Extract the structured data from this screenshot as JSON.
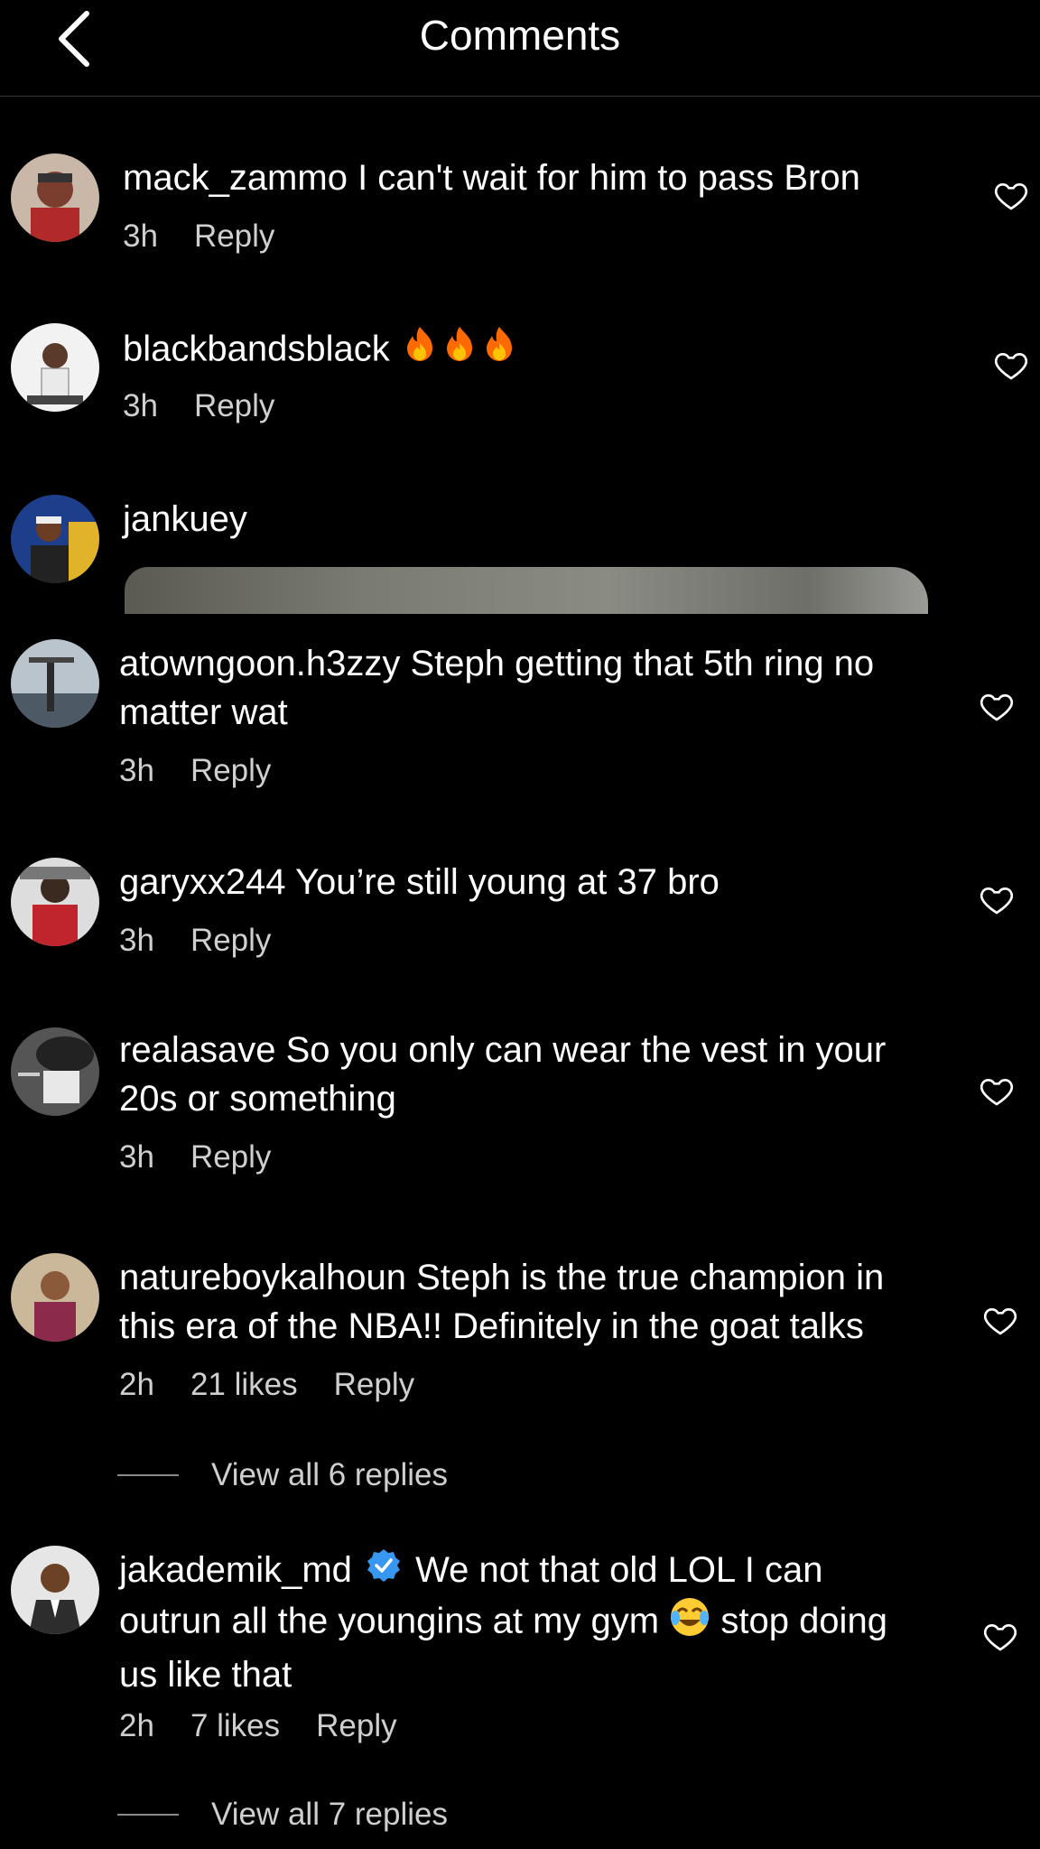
{
  "header": {
    "title": "Comments"
  },
  "comments": [
    {
      "username": "mack_zammo",
      "text": "I can't wait for him to pass Bron",
      "time": "3h",
      "reply": "Reply",
      "avatar": "mack-zammo-avatar"
    },
    {
      "username": "blackbandsblack",
      "text": "🔥🔥🔥",
      "time": "3h",
      "reply": "Reply",
      "avatar": "blackbandsblack-avatar"
    },
    {
      "username": "jankuey",
      "text": "",
      "attachment": "gif-preview",
      "avatar": "jankuey-avatar"
    },
    {
      "username": "atowngoon.h3zzy",
      "text": "Steph getting that 5th ring no",
      "text2": "matter wat",
      "time": "3h",
      "reply": "Reply",
      "avatar": "atowngoon-avatar"
    },
    {
      "username": "garyxx244",
      "text": "You’re still young at 37 bro",
      "time": "3h",
      "reply": "Reply",
      "avatar": "garyxx244-avatar"
    },
    {
      "username": "realasave",
      "text": "So you only can wear the vest in your",
      "text2": "20s or something",
      "time": "3h",
      "reply": "Reply",
      "avatar": "realasave-avatar"
    },
    {
      "username": "natureboykalhoun",
      "text": "Steph is the true champion in",
      "text2": "this era of the NBA!! Definitely in the goat talks",
      "time": "2h",
      "likes": "21 likes",
      "reply": "Reply",
      "view_replies": "View all 6 replies",
      "avatar": "natureboykalhoun-avatar"
    },
    {
      "username": "jakademik_md",
      "verified": true,
      "text": "We not that old LOL I can",
      "text2": "outrun all the youngins at my gym",
      "text2b": "stop doing",
      "text3": "us like that",
      "time": "2h",
      "likes": "7 likes",
      "reply": "Reply",
      "view_replies": "View all 7 replies",
      "avatar": "jakademik-avatar"
    }
  ],
  "icons": {
    "back": "chevron-left-icon",
    "like": "heart-outline-icon",
    "verified": "verified-badge-icon",
    "fire": "fire-emoji",
    "laugh": "tears-of-joy-emoji"
  }
}
